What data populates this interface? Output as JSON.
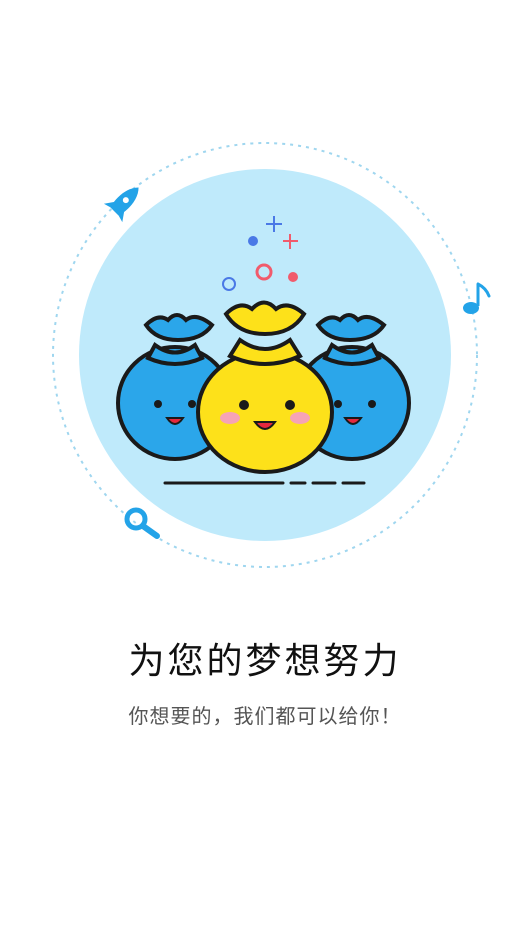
{
  "splash": {
    "title": "为您的梦想努力",
    "subtitle": "你想要的，我们都可以给你！"
  },
  "illustration": {
    "icons": [
      "rocket-icon",
      "music-note-icon",
      "magnifier-icon",
      "sparkle-icon"
    ],
    "characters": [
      "blue-money-bag",
      "yellow-money-bag",
      "blue-money-bag"
    ]
  },
  "colors": {
    "circle_bg": "#bfeafb",
    "blue_bag": "#2ba6ea",
    "yellow_bag": "#fde11a",
    "accent_blue": "#23a3e8",
    "accent_red": "#f15b6c",
    "outline": "#1a1a1a"
  }
}
